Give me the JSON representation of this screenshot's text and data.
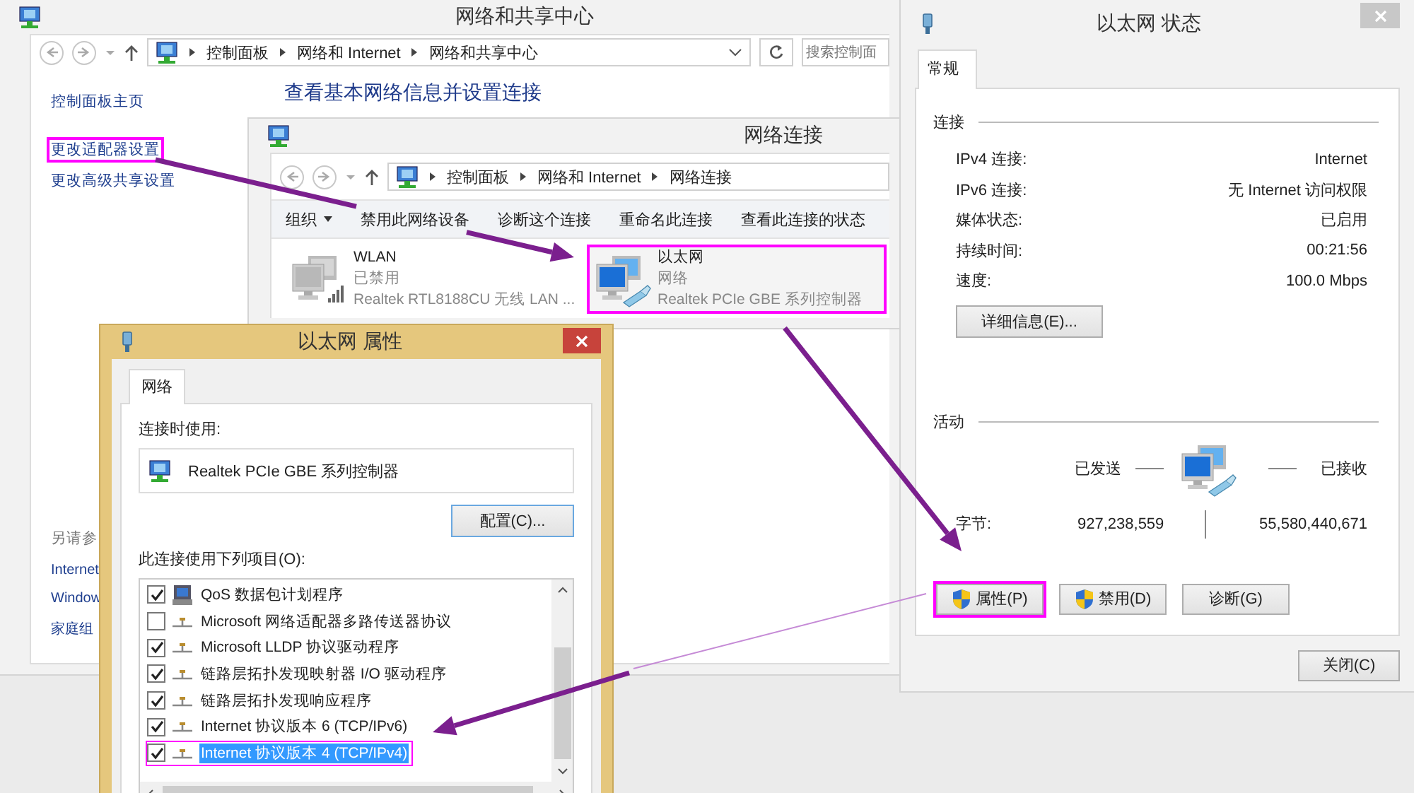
{
  "sharing_center": {
    "title": "网络和共享中心",
    "active": false,
    "breadcrumb": [
      "控制面板",
      "网络和 Internet",
      "网络和共享中心"
    ],
    "search": {
      "placeholder": "搜索控制面"
    },
    "heading": "查看基本网络信息并设置连接",
    "sidebar": {
      "items": [
        {
          "label": "控制面板主页",
          "highlighted": false
        },
        {
          "label": "更改适配器设置",
          "highlighted": true
        },
        {
          "label": "更改高级共享设置",
          "highlighted": false
        }
      ],
      "see_also": {
        "title": "另请参",
        "items": [
          "Internet",
          "Window",
          "家庭组"
        ]
      }
    }
  },
  "network_connections": {
    "title": "网络连接",
    "active": false,
    "breadcrumb": [
      "控制面板",
      "网络和 Internet",
      "网络连接"
    ],
    "toolbar": [
      {
        "label": "组织",
        "kind": "menu"
      },
      {
        "label": "禁用此网络设备",
        "kind": "command"
      },
      {
        "label": "诊断这个连接",
        "kind": "command"
      },
      {
        "label": "重命名此连接",
        "kind": "command"
      },
      {
        "label": "查看此连接的状态",
        "kind": "command"
      }
    ],
    "connections": [
      {
        "name": "WLAN",
        "status": "已禁用",
        "adapter": "Realtek RTL8188CU 无线 LAN ...",
        "kind": "wireless",
        "enabled": false,
        "highlighted": false
      },
      {
        "name": "以太网",
        "status": "网络",
        "adapter": "Realtek PCIe GBE 系列控制器",
        "kind": "wired",
        "enabled": true,
        "highlighted": true
      }
    ]
  },
  "properties_dialog": {
    "title": "以太网 属性",
    "active": true,
    "tabs": [
      {
        "label": "网络",
        "selected": true
      }
    ],
    "connect_using_label": "连接时使用:",
    "adapter": "Realtek PCIe GBE 系列控制器",
    "configure_button": "配置(C)...",
    "items_label": "此连接使用下列项目(O):",
    "items": [
      {
        "label": "QoS 数据包计划程序",
        "kind": "service",
        "checked": true,
        "selected": false,
        "highlighted": false
      },
      {
        "label": "Microsoft 网络适配器多路传送器协议",
        "kind": "protocol",
        "checked": false,
        "selected": false,
        "highlighted": false
      },
      {
        "label": "Microsoft LLDP 协议驱动程序",
        "kind": "protocol",
        "checked": true,
        "selected": false,
        "highlighted": false
      },
      {
        "label": "链路层拓扑发现映射器 I/O 驱动程序",
        "kind": "protocol",
        "checked": true,
        "selected": false,
        "highlighted": false
      },
      {
        "label": "链路层拓扑发现响应程序",
        "kind": "protocol",
        "checked": true,
        "selected": false,
        "highlighted": false
      },
      {
        "label": "Internet 协议版本 6 (TCP/IPv6)",
        "kind": "protocol",
        "checked": true,
        "selected": false,
        "highlighted": false
      },
      {
        "label": "Internet 协议版本 4 (TCP/IPv4)",
        "kind": "protocol",
        "checked": true,
        "selected": true,
        "highlighted": true
      }
    ]
  },
  "status_dialog": {
    "title": "以太网 状态",
    "active": false,
    "tabs": [
      {
        "label": "常规",
        "selected": true
      }
    ],
    "connection_section": "连接",
    "fields": [
      {
        "label": "IPv4 连接:",
        "value": "Internet"
      },
      {
        "label": "IPv6 连接:",
        "value": "无 Internet 访问权限"
      },
      {
        "label": "媒体状态:",
        "value": "已启用"
      },
      {
        "label": "持续时间:",
        "value": "00:21:56"
      },
      {
        "label": "速度:",
        "value": "100.0 Mbps"
      }
    ],
    "details_button": "详细信息(E)...",
    "activity_section": "活动",
    "sent_label": "已发送",
    "received_label": "已接收",
    "bytes_label": "字节:",
    "bytes_sent": "927,238,559",
    "bytes_received": "55,580,440,671",
    "buttons": [
      {
        "label": "属性(P)",
        "shield": true,
        "highlighted": true
      },
      {
        "label": "禁用(D)",
        "shield": true,
        "highlighted": false
      },
      {
        "label": "诊断(G)",
        "shield": false,
        "highlighted": false
      }
    ],
    "close_button": "关闭(C)"
  }
}
